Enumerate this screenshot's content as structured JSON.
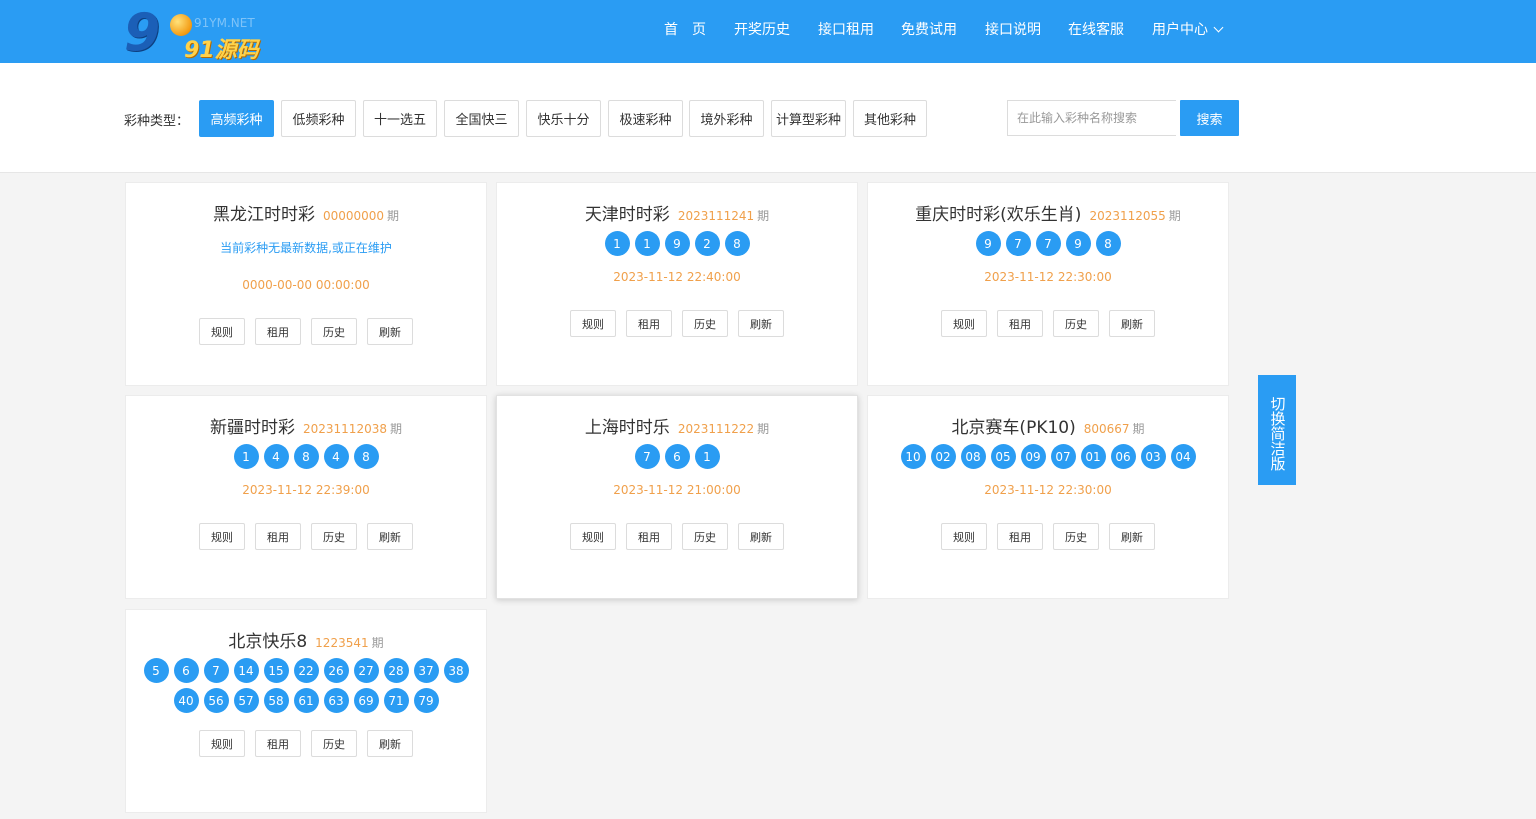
{
  "brand": {
    "site": "91YM.NET",
    "name": "91源码"
  },
  "nav": {
    "items": [
      {
        "label": "首　页"
      },
      {
        "label": "开奖历史"
      },
      {
        "label": "接口租用"
      },
      {
        "label": "免费试用"
      },
      {
        "label": "接口说明"
      },
      {
        "label": "在线客服"
      },
      {
        "label": "用户中心"
      }
    ]
  },
  "filter": {
    "label": "彩种类型：",
    "categories": [
      {
        "label": "高频彩种",
        "active": true
      },
      {
        "label": "低频彩种"
      },
      {
        "label": "十一选五"
      },
      {
        "label": "全国快三"
      },
      {
        "label": "快乐十分"
      },
      {
        "label": "极速彩种"
      },
      {
        "label": "境外彩种"
      },
      {
        "label": "计算型彩种"
      },
      {
        "label": "其他彩种"
      }
    ],
    "search_placeholder": "在此输入彩种名称搜索",
    "search_label": "搜索"
  },
  "qi_label": "期",
  "actions": {
    "rules": "规则",
    "rent": "租用",
    "history": "历史",
    "refresh": "刷新"
  },
  "cards": [
    {
      "name": "黑龙江时时彩",
      "issue": "00000000",
      "notice": "当前彩种无最新数据,或正在维护",
      "balls": [],
      "time": "0000-00-00 00:00:00"
    },
    {
      "name": "天津时时彩",
      "issue": "2023111241",
      "balls": [
        "1",
        "1",
        "9",
        "2",
        "8"
      ],
      "time": "2023-11-12 22:40:00"
    },
    {
      "name": "重庆时时彩(欢乐生肖)",
      "issue": "2023112055",
      "balls": [
        "9",
        "7",
        "7",
        "9",
        "8"
      ],
      "time": "2023-11-12 22:30:00"
    },
    {
      "name": "新疆时时彩",
      "issue": "20231112038",
      "balls": [
        "1",
        "4",
        "8",
        "4",
        "8"
      ],
      "time": "2023-11-12 22:39:00"
    },
    {
      "name": "上海时时乐",
      "issue": "2023111222",
      "balls": [
        "7",
        "6",
        "1"
      ],
      "time": "2023-11-12 21:00:00"
    },
    {
      "name": "北京赛车(PK10)",
      "issue": "800667",
      "balls": [
        "10",
        "02",
        "08",
        "05",
        "09",
        "07",
        "01",
        "06",
        "03",
        "04"
      ],
      "time": "2023-11-12 22:30:00"
    },
    {
      "name": "北京快乐8",
      "issue": "1223541",
      "balls": [
        "5",
        "6",
        "7",
        "14",
        "15",
        "22",
        "26",
        "27",
        "28",
        "37",
        "38",
        "40",
        "56",
        "57",
        "58",
        "61",
        "63",
        "69",
        "71",
        "79"
      ],
      "time": ""
    }
  ],
  "side": {
    "label": "切换简洁版"
  },
  "colors": {
    "primary": "#2a9cf3",
    "issue": "#f0a04b",
    "background": "#f4f4f4"
  }
}
